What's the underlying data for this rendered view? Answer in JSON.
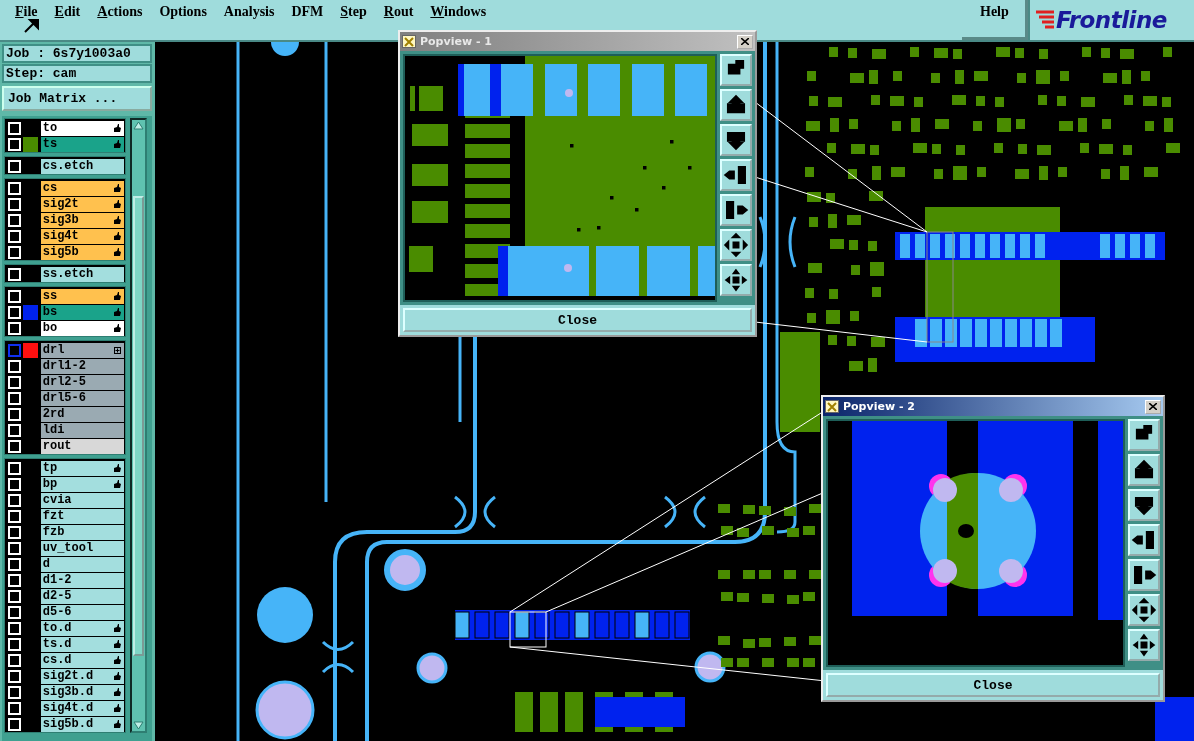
{
  "menu": {
    "items": [
      {
        "label": "File",
        "underlined": true
      },
      {
        "label": "Edit",
        "underlined": true
      },
      {
        "label": "Actions",
        "underlined": true
      },
      {
        "label": "Options",
        "underlined": false
      },
      {
        "label": "Analysis",
        "underlined": false
      },
      {
        "label": "DFM",
        "underlined": false
      },
      {
        "label": "Step",
        "underlined": true
      },
      {
        "label": "Rout",
        "underlined": true
      },
      {
        "label": "Windows",
        "underlined": true
      }
    ],
    "help": "Help",
    "logo": "Frontline"
  },
  "job": {
    "job": "Job : 6s7y1003a0",
    "step": "Step: cam",
    "matrix_button": "Job Matrix ..."
  },
  "layer_groups": [
    [
      {
        "name": "to",
        "kind": "silk",
        "selected": false,
        "affected": true,
        "expandable": false
      },
      {
        "name": "ts",
        "kind": "mask",
        "selected": false,
        "affected": true,
        "expandable": false,
        "color": "#4a8c00"
      }
    ],
    [
      {
        "name": "cs.etch",
        "kind": "doc",
        "selected": false,
        "affected": false,
        "expandable": false
      }
    ],
    [
      {
        "name": "cs",
        "kind": "signal",
        "selected": false,
        "affected": true,
        "expandable": false
      },
      {
        "name": "sig2t",
        "kind": "signal",
        "selected": false,
        "affected": true,
        "expandable": false
      },
      {
        "name": "sig3b",
        "kind": "signal",
        "selected": false,
        "affected": true,
        "expandable": false
      },
      {
        "name": "sig4t",
        "kind": "signal",
        "selected": false,
        "affected": true,
        "expandable": false
      },
      {
        "name": "sig5b",
        "kind": "signal",
        "selected": false,
        "affected": true,
        "expandable": false
      }
    ],
    [
      {
        "name": "ss.etch",
        "kind": "doc",
        "selected": false,
        "affected": false,
        "expandable": false
      }
    ],
    [
      {
        "name": "ss",
        "kind": "signal",
        "selected": false,
        "affected": true,
        "expandable": false
      },
      {
        "name": "bs",
        "kind": "mask",
        "selected": false,
        "affected": true,
        "expandable": false,
        "color": "#0022ee"
      },
      {
        "name": "bo",
        "kind": "silk",
        "selected": false,
        "affected": true,
        "expandable": false
      }
    ],
    [
      {
        "name": "drl",
        "kind": "drill",
        "selected": true,
        "affected": false,
        "expandable": true,
        "color": "#ff1010"
      },
      {
        "name": "drl1-2",
        "kind": "drill",
        "selected": false,
        "affected": false,
        "expandable": false
      },
      {
        "name": "drl2-5",
        "kind": "drill",
        "selected": false,
        "affected": false,
        "expandable": false
      },
      {
        "name": "drl5-6",
        "kind": "drill",
        "selected": false,
        "affected": false,
        "expandable": false
      },
      {
        "name": "2rd",
        "kind": "drill",
        "selected": false,
        "affected": false,
        "expandable": false
      },
      {
        "name": "ldi",
        "kind": "drill",
        "selected": false,
        "affected": false,
        "expandable": false
      },
      {
        "name": "rout",
        "kind": "rout",
        "selected": false,
        "affected": false,
        "expandable": false
      }
    ],
    [
      {
        "name": "tp",
        "kind": "doc",
        "selected": false,
        "affected": true,
        "expandable": false
      },
      {
        "name": "bp",
        "kind": "doc",
        "selected": false,
        "affected": true,
        "expandable": false
      },
      {
        "name": "cvia",
        "kind": "doc",
        "selected": false,
        "affected": false,
        "expandable": false
      },
      {
        "name": "fzt",
        "kind": "doc",
        "selected": false,
        "affected": false,
        "expandable": false
      },
      {
        "name": "fzb",
        "kind": "doc",
        "selected": false,
        "affected": false,
        "expandable": false
      },
      {
        "name": "uv_tool",
        "kind": "doc",
        "selected": false,
        "affected": false,
        "expandable": false
      },
      {
        "name": "d",
        "kind": "doc",
        "selected": false,
        "affected": false,
        "expandable": false
      },
      {
        "name": "d1-2",
        "kind": "doc",
        "selected": false,
        "affected": false,
        "expandable": false
      },
      {
        "name": "d2-5",
        "kind": "doc",
        "selected": false,
        "affected": false,
        "expandable": false
      },
      {
        "name": "d5-6",
        "kind": "doc",
        "selected": false,
        "affected": false,
        "expandable": false
      },
      {
        "name": "to.d",
        "kind": "doc",
        "selected": false,
        "affected": true,
        "expandable": false
      },
      {
        "name": "ts.d",
        "kind": "doc",
        "selected": false,
        "affected": true,
        "expandable": false
      },
      {
        "name": "cs.d",
        "kind": "doc",
        "selected": false,
        "affected": true,
        "expandable": false
      },
      {
        "name": "sig2t.d",
        "kind": "doc",
        "selected": false,
        "affected": true,
        "expandable": false
      },
      {
        "name": "sig3b.d",
        "kind": "doc",
        "selected": false,
        "affected": true,
        "expandable": false
      },
      {
        "name": "sig4t.d",
        "kind": "doc",
        "selected": false,
        "affected": true,
        "expandable": false
      },
      {
        "name": "sig5b.d",
        "kind": "doc",
        "selected": false,
        "affected": true,
        "expandable": false
      }
    ]
  ],
  "popviews": [
    {
      "title": "Popview - 1",
      "active": false,
      "close": "Close"
    },
    {
      "title": "Popview - 2",
      "active": true,
      "close": "Close"
    }
  ]
}
